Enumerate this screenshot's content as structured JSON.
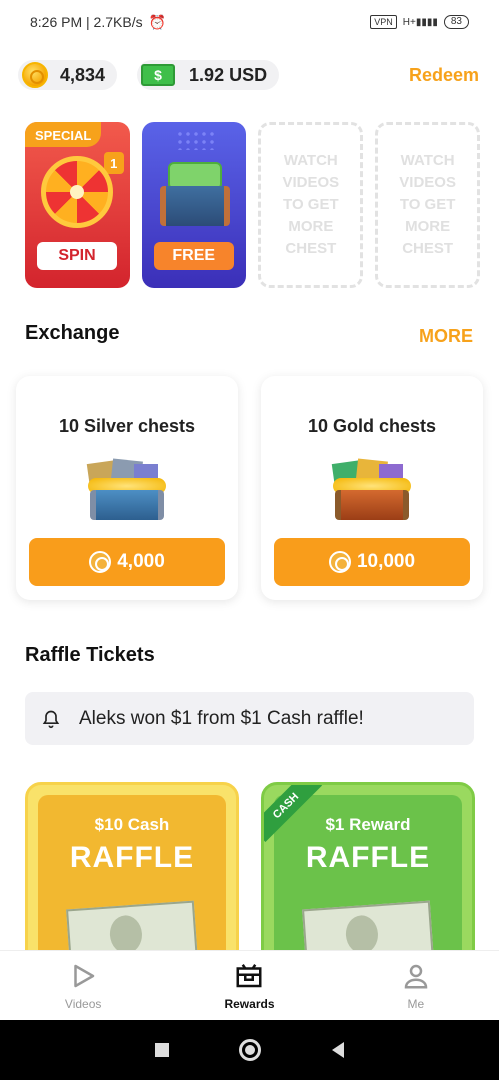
{
  "status_bar": {
    "time_speed": "8:26 PM | 2.7KB/s",
    "vpn": "VPN",
    "signal_label": "H+",
    "battery": "83"
  },
  "balance": {
    "coins": "4,834",
    "cash": "1.92 USD",
    "redeem_label": "Redeem"
  },
  "chests": {
    "special_tag": "SPECIAL",
    "special_count": "1",
    "spin_label": "SPIN",
    "free_label": "FREE",
    "placeholder_text": "WATCH VIDEOS TO GET MORE CHEST"
  },
  "exchange": {
    "title": "Exchange",
    "more_label": "MORE",
    "items": [
      {
        "name": "10 Silver chests",
        "price": "4,000"
      },
      {
        "name": "10 Gold chests",
        "price": "10,000"
      }
    ]
  },
  "raffle": {
    "title": "Raffle Tickets",
    "notice": "Aleks won $1 from $1 Cash raffle!",
    "cards": [
      {
        "subtitle": "$10 Cash",
        "title": "RAFFLE"
      },
      {
        "subtitle": "$1 Reward",
        "title": "RAFFLE",
        "ribbon": "CASH"
      }
    ]
  },
  "nav": {
    "videos": "Videos",
    "rewards": "Rewards",
    "me": "Me"
  },
  "colors": {
    "accent": "#f7a21b",
    "button_orange": "#f99d1b"
  }
}
